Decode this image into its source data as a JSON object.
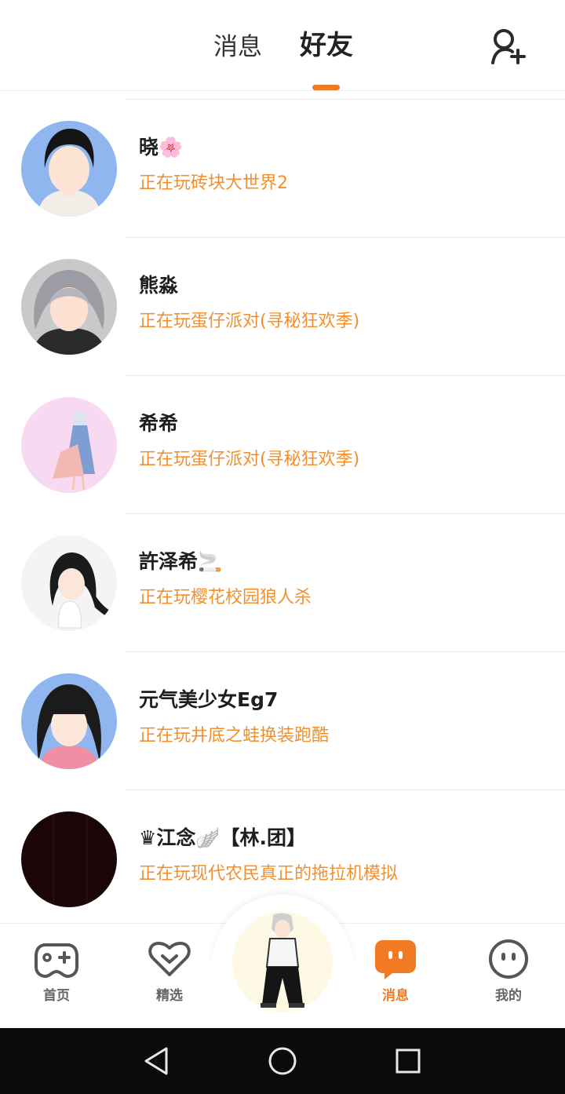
{
  "header": {
    "tabs": [
      {
        "label": "消息",
        "active": false
      },
      {
        "label": "好友",
        "active": true
      }
    ],
    "accent": "#f27a22",
    "add_friend_icon": "add-user-icon"
  },
  "friends": [
    {
      "name": "晓🌸",
      "status": "正在玩砖块大世界2",
      "avatar_bg": "#8fb6ee"
    },
    {
      "name": "熊淼",
      "status": "正在玩蛋仔派对(寻秘狂欢季)",
      "avatar_bg": "#c9c9c9"
    },
    {
      "name": "希希",
      "status": "正在玩蛋仔派对(寻秘狂欢季)",
      "avatar_bg": "#f8d9f2"
    },
    {
      "name": "許泽希🚬",
      "status": "正在玩樱花校园狼人杀",
      "avatar_bg": "#f4f4f4"
    },
    {
      "name": "元气美少女Eg7",
      "status": "正在玩井底之蛙换装跑酷",
      "avatar_bg": "#8fb6ee"
    },
    {
      "name": "♛江念🪽【林.团】",
      "status": "正在玩现代农民真正的拖拉机模拟",
      "avatar_bg": "#1a0606"
    }
  ],
  "status_color": "#f0902f",
  "bottom_nav": {
    "items": [
      {
        "label": "首页",
        "icon": "gamepad-icon",
        "active": false
      },
      {
        "label": "精选",
        "icon": "heart-chevron-icon",
        "active": false
      },
      {
        "label": "消息",
        "icon": "chat-bubble-icon",
        "active": true
      },
      {
        "label": "我的",
        "icon": "face-icon",
        "active": false
      }
    ]
  },
  "system_nav": {
    "buttons": [
      "back-icon",
      "home-icon",
      "recents-icon"
    ]
  }
}
